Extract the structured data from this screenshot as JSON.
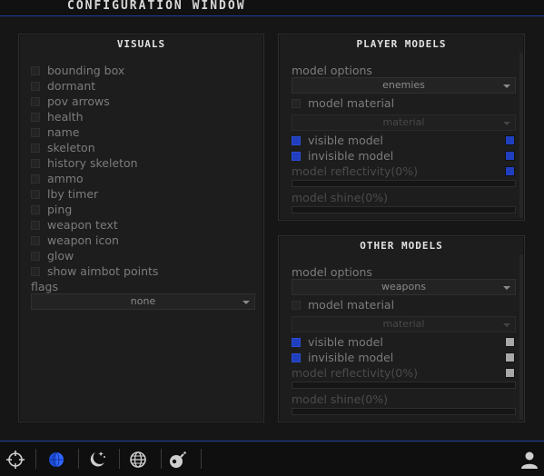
{
  "window": {
    "title": "CONFIGURATION WINDOW"
  },
  "colors": {
    "accent": "#1f3fbf",
    "grey_swatch": "#a8a8a8"
  },
  "visuals": {
    "title": "VISUALS",
    "items": [
      {
        "label": "bounding box",
        "checked": false
      },
      {
        "label": "dormant",
        "checked": false
      },
      {
        "label": "pov arrows",
        "checked": false
      },
      {
        "label": "health",
        "checked": false
      },
      {
        "label": "name",
        "checked": false
      },
      {
        "label": "skeleton",
        "checked": false
      },
      {
        "label": "history skeleton",
        "checked": false
      },
      {
        "label": "ammo",
        "checked": false
      },
      {
        "label": "lby timer",
        "checked": false
      },
      {
        "label": "ping",
        "checked": false
      },
      {
        "label": "weapon text",
        "checked": false
      },
      {
        "label": "weapon icon",
        "checked": false
      },
      {
        "label": "glow",
        "checked": false
      },
      {
        "label": "show aimbot points",
        "checked": false
      }
    ],
    "flags_label": "flags",
    "flags_value": "none"
  },
  "player_models": {
    "title": "PLAYER MODELS",
    "options_label": "model options",
    "options_value": "enemies",
    "material_label": "model material",
    "material_value": "material",
    "visible_label": "visible model",
    "invisible_label": "invisible model",
    "reflectivity_label": "model reflectivity(0%)",
    "reflectivity_value": 0,
    "shine_label": "model shine(0%)",
    "shine_value": 0
  },
  "other_models": {
    "title": "OTHER MODELS",
    "options_label": "model options",
    "options_value": "weapons",
    "material_label": "model material",
    "material_value": "material",
    "visible_label": "visible model",
    "invisible_label": "invisible model",
    "reflectivity_label": "model reflectivity(0%)",
    "reflectivity_value": 0,
    "shine_label": "model shine(0%)",
    "shine_value": 0
  },
  "tabs": [
    "crosshair-icon",
    "globe-half-icon",
    "moon-stars-icon",
    "world-icon",
    "bomb-icon",
    "user-icon"
  ]
}
